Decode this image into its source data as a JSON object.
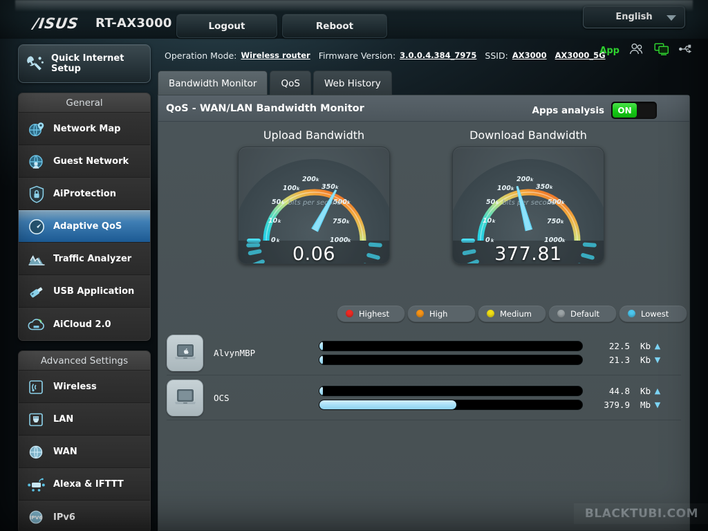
{
  "header": {
    "brand": "/ISUS",
    "model": "RT-AX3000",
    "logout_label": "Logout",
    "reboot_label": "Reboot",
    "language": "English",
    "app_label": "App"
  },
  "status": {
    "op_mode_label": "Operation Mode:",
    "op_mode_value": "Wireless router",
    "firmware_label": "Firmware Version:",
    "firmware_value": "3.0.0.4.384_7975",
    "ssid_label": "SSID:",
    "ssid_1": "AX3000",
    "ssid_2": "AX3000_5G"
  },
  "sidebar": {
    "quick_setup": "Quick Internet Setup",
    "groups": [
      {
        "title": "General",
        "items": [
          {
            "label": "Network Map",
            "icon": "globe-pin-icon",
            "active": false
          },
          {
            "label": "Guest Network",
            "icon": "globe-users-icon",
            "active": false
          },
          {
            "label": "AiProtection",
            "icon": "shield-lock-icon",
            "active": false
          },
          {
            "label": "Adaptive QoS",
            "icon": "speedometer-icon",
            "active": true
          },
          {
            "label": "Traffic Analyzer",
            "icon": "chart-peaks-icon",
            "active": false
          },
          {
            "label": "USB Application",
            "icon": "usb-drive-icon",
            "active": false
          },
          {
            "label": "AiCloud 2.0",
            "icon": "cloud-icon",
            "active": false
          }
        ]
      },
      {
        "title": "Advanced Settings",
        "items": [
          {
            "label": "Wireless",
            "icon": "wifi-signal-icon",
            "active": false
          },
          {
            "label": "LAN",
            "icon": "ethernet-port-icon",
            "active": false
          },
          {
            "label": "WAN",
            "icon": "globe-icon",
            "active": false
          },
          {
            "label": "Alexa & IFTTT",
            "icon": "alexa-ifttt-icon",
            "active": false
          },
          {
            "label": "IPv6",
            "icon": "ipv6-globe-icon",
            "active": false
          }
        ]
      }
    ]
  },
  "main": {
    "tabs": [
      {
        "label": "Bandwidth Monitor",
        "active": true
      },
      {
        "label": "QoS",
        "active": false
      },
      {
        "label": "Web History",
        "active": false
      }
    ],
    "panel_title": "QoS - WAN/LAN Bandwidth Monitor",
    "apps_analysis_label": "Apps analysis",
    "apps_analysis_state": "ON"
  },
  "chart_data": [
    {
      "type": "gauge",
      "title": "Upload Bandwidth",
      "value": 0.06,
      "value_text": "0.06",
      "unit_text": "bits per second",
      "tick_labels": [
        "0k",
        "10k",
        "50k",
        "100k",
        "200k",
        "350k",
        "500k",
        "750k",
        "1000k"
      ],
      "scale_values": [
        0,
        10,
        50,
        100,
        200,
        350,
        500,
        750,
        1000
      ],
      "needle_angle_deg": -62,
      "ylim": [
        0,
        1000
      ]
    },
    {
      "type": "gauge",
      "title": "Download Bandwidth",
      "value": 377.81,
      "value_text": "377.81",
      "unit_text": "bits per second",
      "tick_labels": [
        "0k",
        "10k",
        "50k",
        "100k",
        "200k",
        "350k",
        "500k",
        "750k",
        "1000k"
      ],
      "scale_values": [
        0,
        10,
        50,
        100,
        200,
        350,
        500,
        750,
        1000
      ],
      "needle_angle_deg": -8,
      "ylim": [
        0,
        1000
      ]
    }
  ],
  "legend": [
    {
      "label": "Highest",
      "color": "#ef2b24"
    },
    {
      "label": "High",
      "color": "#f79417"
    },
    {
      "label": "Medium",
      "color": "#f2e015"
    },
    {
      "label": "Default",
      "color": "#9ba3a6"
    },
    {
      "label": "Lowest",
      "color": "#4cc7ef"
    }
  ],
  "devices": [
    {
      "name": "AlvynMBP",
      "icon": "apple-laptop-icon",
      "upload": {
        "value": "22.5",
        "unit": "Kb",
        "arrow": "up",
        "fill_pct": 1.2
      },
      "download": {
        "value": "21.3",
        "unit": "Kb",
        "arrow": "down",
        "fill_pct": 1.2
      }
    },
    {
      "name": "OCS",
      "icon": "desktop-monitor-icon",
      "upload": {
        "value": "44.8",
        "unit": "Kb",
        "arrow": "up",
        "fill_pct": 1.2
      },
      "download": {
        "value": "379.9",
        "unit": "Mb",
        "arrow": "down",
        "fill_pct": 52
      }
    }
  ],
  "watermark": "BLACKTUBI.COM"
}
